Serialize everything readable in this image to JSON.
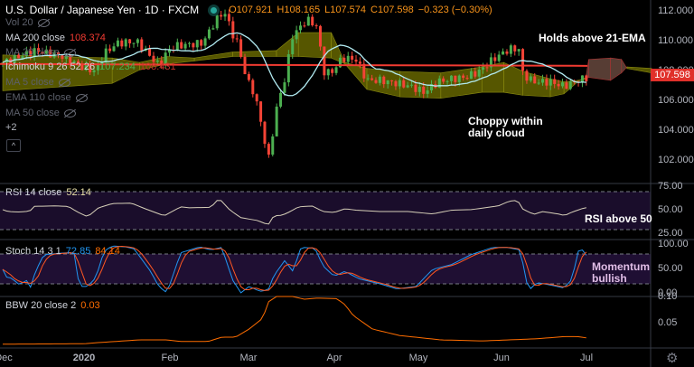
{
  "header": {
    "title": "U.S. Dollar / Japanese Yen · 1D · FXCM",
    "open": "O107.921",
    "high": "H108.165",
    "low": "L107.574",
    "close": "C107.598",
    "change": "−0.323 (−0.30%)"
  },
  "legend": {
    "vol": "Vol 20",
    "ma200": "MA 200 close",
    "ma200_val": "108.374",
    "ma20": "MA 20 close",
    "ichimoku": "Ichimoku 9 26 52 26",
    "ichi_v1": "107.234",
    "ichi_v2": "108.431",
    "ma5": "MA 5 close",
    "ema110": "EMA 110 close",
    "ma50": "MA 50 close",
    "more": "+2",
    "rsi": "RSI 14 close",
    "rsi_val": "52.14",
    "stoch": "Stoch 14 3 1",
    "stoch_k": "72.85",
    "stoch_d": "84.14",
    "bbw": "BBW 20 close 2",
    "bbw_val": "0.03"
  },
  "annotations": {
    "ema": "Holds above 21-EMA",
    "cloud1": "Choppy within",
    "cloud2": "daily cloud",
    "rsi": "RSI above 50",
    "mom1": "Momentum",
    "mom2": "bullish"
  },
  "price_axis": [
    "112.000",
    "110.000",
    "108.000",
    "106.000",
    "104.000",
    "102.000"
  ],
  "last_price": "107.598",
  "rsi_axis": [
    "75.00",
    "50.00",
    "25.00"
  ],
  "stoch_axis": [
    "100.00",
    "50.00",
    "0.00"
  ],
  "bbw_axis": [
    "0.10",
    "0.05"
  ],
  "time_axis": [
    "Dec",
    "2020",
    "Feb",
    "Mar",
    "Apr",
    "May",
    "Jun",
    "Jul"
  ],
  "colors": {
    "up": "#4caf50",
    "down": "#f44336",
    "ma20": "#b2ebf2",
    "ma200": "#f23b32",
    "rsi": "#d6cfb8",
    "stochK": "#2196f3",
    "stochD": "#ff5722",
    "bbw": "#ff6d00",
    "bull_cloud": "#6b6b00",
    "bear_cloud": "#6d4c41"
  },
  "chart_data": {
    "type": "line",
    "x_unit": "days since Dec 1 2019",
    "price_close": [
      [
        0,
        108.6
      ],
      [
        12,
        109.4
      ],
      [
        22,
        109.0
      ],
      [
        29,
        108.3
      ],
      [
        34,
        108.0
      ],
      [
        37,
        109.2
      ],
      [
        42,
        109.9
      ],
      [
        49,
        110.0
      ],
      [
        53,
        109.2
      ],
      [
        57,
        108.4
      ],
      [
        60,
        109.3
      ],
      [
        63,
        109.7
      ],
      [
        68,
        109.8
      ],
      [
        73,
        109.9
      ],
      [
        78,
        111.5
      ],
      [
        81,
        112.0
      ],
      [
        84,
        110.5
      ],
      [
        86,
        109.8
      ],
      [
        89,
        107.5
      ],
      [
        92,
        106.5
      ],
      [
        95,
        104.0
      ],
      [
        97,
        102.0
      ],
      [
        100,
        105.5
      ],
      [
        103,
        107.5
      ],
      [
        106,
        110.5
      ],
      [
        109,
        111.0
      ],
      [
        111,
        111.5
      ],
      [
        115,
        111.0
      ],
      [
        117,
        108.0
      ],
      [
        120,
        107.9
      ],
      [
        124,
        108.9
      ],
      [
        129,
        108.8
      ],
      [
        133,
        107.4
      ],
      [
        138,
        107.4
      ],
      [
        144,
        107.2
      ],
      [
        149,
        107.0
      ],
      [
        154,
        106.6
      ],
      [
        159,
        107.3
      ],
      [
        164,
        107.5
      ],
      [
        169,
        107.6
      ],
      [
        174,
        108.0
      ],
      [
        179,
        108.8
      ],
      [
        185,
        109.5
      ],
      [
        189,
        109.5
      ],
      [
        190,
        107.8
      ],
      [
        194,
        107.3
      ],
      [
        200,
        107.3
      ],
      [
        205,
        107.0
      ],
      [
        210,
        107.4
      ],
      [
        214,
        107.6
      ]
    ],
    "ma200": 108.374,
    "ichimoku_cloud": [
      [
        0,
        109.1,
        106.7
      ],
      [
        40,
        108.9,
        107.2
      ],
      [
        50,
        108.6,
        108.1
      ],
      [
        60,
        109.0,
        108.5
      ],
      [
        70,
        108.9,
        108.7
      ],
      [
        84,
        109.3,
        109.0
      ],
      [
        100,
        109.4,
        109.0
      ],
      [
        108,
        110.6,
        109.0
      ],
      [
        120,
        110.6,
        108.9
      ],
      [
        125,
        108.6,
        108.5
      ],
      [
        133,
        108.2,
        106.8
      ],
      [
        145,
        108.0,
        106.3
      ],
      [
        160,
        107.9,
        106.2
      ],
      [
        175,
        108.3,
        106.6
      ],
      [
        183,
        108.6,
        106.6
      ],
      [
        190,
        108.0,
        106.4
      ],
      [
        200,
        107.5,
        106.3
      ],
      [
        205,
        107.3,
        106.5
      ],
      [
        210,
        107.4,
        107.3
      ],
      [
        213,
        107.5,
        107.6
      ],
      [
        214,
        107.6,
        108.8
      ],
      [
        222,
        107.4,
        108.9
      ],
      [
        226,
        107.9,
        108.8
      ],
      [
        228,
        108.3,
        108.2
      ],
      [
        237,
        108.2,
        107.9
      ]
    ],
    "rsi": [
      [
        0,
        52
      ],
      [
        2,
        48
      ],
      [
        6,
        47
      ],
      [
        10,
        49
      ],
      [
        11,
        59
      ],
      [
        19,
        60
      ],
      [
        24,
        59
      ],
      [
        27,
        48
      ],
      [
        31,
        37
      ],
      [
        35,
        56
      ],
      [
        40,
        65
      ],
      [
        47,
        66
      ],
      [
        52,
        54
      ],
      [
        59,
        39
      ],
      [
        65,
        58
      ],
      [
        68,
        56
      ],
      [
        76,
        57
      ],
      [
        79,
        76
      ],
      [
        83,
        51
      ],
      [
        87,
        35
      ],
      [
        93,
        29
      ],
      [
        97,
        20
      ],
      [
        99,
        39
      ],
      [
        102,
        40
      ],
      [
        105,
        48
      ],
      [
        108,
        58
      ],
      [
        113,
        60
      ],
      [
        117,
        48
      ],
      [
        121,
        46
      ],
      [
        125,
        54
      ],
      [
        129,
        51
      ],
      [
        138,
        48
      ],
      [
        148,
        48
      ],
      [
        157,
        43
      ],
      [
        164,
        51
      ],
      [
        171,
        52
      ],
      [
        181,
        60
      ],
      [
        185,
        70
      ],
      [
        188,
        72
      ],
      [
        190,
        53
      ],
      [
        194,
        42
      ],
      [
        197,
        48
      ],
      [
        204,
        42
      ],
      [
        205,
        39
      ],
      [
        208,
        47
      ],
      [
        213,
        57
      ],
      [
        214,
        52
      ]
    ],
    "stoch_k": [
      [
        0,
        50
      ],
      [
        2,
        28
      ],
      [
        3,
        33
      ],
      [
        6,
        19
      ],
      [
        9,
        28
      ],
      [
        10,
        11
      ],
      [
        12,
        46
      ],
      [
        15,
        80
      ],
      [
        21,
        83
      ],
      [
        26,
        85
      ],
      [
        28,
        15
      ],
      [
        31,
        15
      ],
      [
        34,
        33
      ],
      [
        37,
        87
      ],
      [
        40,
        98
      ],
      [
        45,
        96
      ],
      [
        48,
        92
      ],
      [
        54,
        46
      ],
      [
        57,
        15
      ],
      [
        60,
        2
      ],
      [
        65,
        84
      ],
      [
        72,
        96
      ],
      [
        76,
        90
      ],
      [
        80,
        95
      ],
      [
        84,
        28
      ],
      [
        87,
        2
      ],
      [
        90,
        15
      ],
      [
        94,
        5
      ],
      [
        97,
        8
      ],
      [
        99,
        37
      ],
      [
        103,
        68
      ],
      [
        106,
        46
      ],
      [
        109,
        96
      ],
      [
        111,
        94
      ],
      [
        114,
        94
      ],
      [
        117,
        57
      ],
      [
        121,
        36
      ],
      [
        125,
        46
      ],
      [
        130,
        31
      ],
      [
        138,
        20
      ],
      [
        144,
        10
      ],
      [
        151,
        15
      ],
      [
        157,
        50
      ],
      [
        164,
        60
      ],
      [
        171,
        80
      ],
      [
        179,
        95
      ],
      [
        184,
        95
      ],
      [
        189,
        90
      ],
      [
        192,
        6
      ],
      [
        195,
        23
      ],
      [
        200,
        18
      ],
      [
        205,
        12
      ],
      [
        208,
        30
      ],
      [
        210,
        85
      ],
      [
        211,
        95
      ],
      [
        213,
        80
      ],
      [
        214,
        73
      ]
    ],
    "bbw": [
      [
        0,
        0.012
      ],
      [
        30,
        0.013
      ],
      [
        35,
        0.015
      ],
      [
        50,
        0.02
      ],
      [
        60,
        0.02
      ],
      [
        65,
        0.017
      ],
      [
        75,
        0.017
      ],
      [
        80,
        0.025
      ],
      [
        85,
        0.025
      ],
      [
        90,
        0.04
      ],
      [
        95,
        0.06
      ],
      [
        97,
        0.09
      ],
      [
        100,
        0.1
      ],
      [
        106,
        0.1
      ],
      [
        110,
        0.095
      ],
      [
        115,
        0.097
      ],
      [
        122,
        0.096
      ],
      [
        125,
        0.085
      ],
      [
        128,
        0.065
      ],
      [
        135,
        0.04
      ],
      [
        145,
        0.028
      ],
      [
        160,
        0.02
      ],
      [
        175,
        0.018
      ],
      [
        185,
        0.02
      ],
      [
        195,
        0.022
      ],
      [
        205,
        0.026
      ],
      [
        210,
        0.026
      ],
      [
        214,
        0.023
      ]
    ],
    "price_ylim": [
      101,
      113
    ],
    "rsi_ylim": [
      25,
      75
    ],
    "stoch_ylim": [
      0,
      100
    ],
    "bbw_ylim": [
      0,
      0.1
    ]
  }
}
